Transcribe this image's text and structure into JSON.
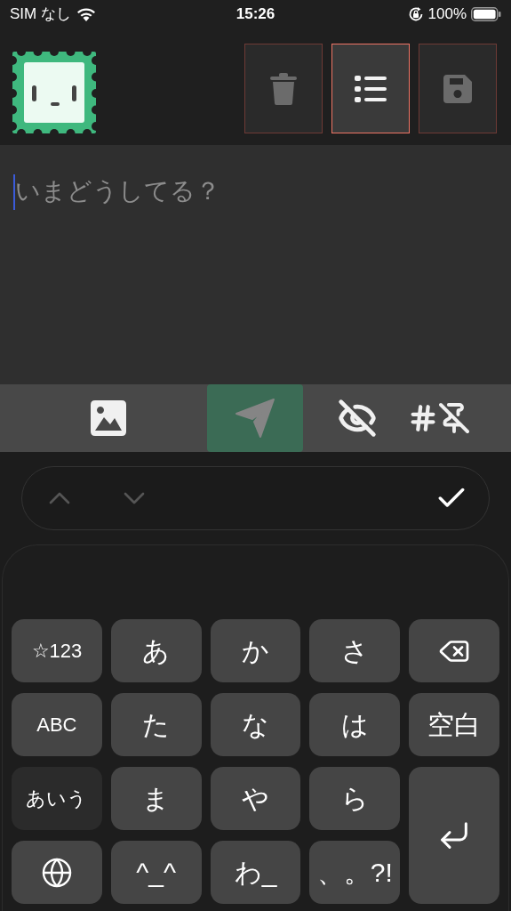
{
  "status_bar": {
    "carrier": "SIM なし",
    "time": "15:26",
    "battery": "100%"
  },
  "header": {
    "buttons": [
      {
        "kind": "trash",
        "selected": false
      },
      {
        "kind": "list",
        "selected": true
      },
      {
        "kind": "save",
        "selected": false
      }
    ]
  },
  "composer": {
    "placeholder": "いまどうしてる？"
  },
  "toolbar": [
    {
      "kind": "image",
      "selected": false
    },
    {
      "kind": "send",
      "selected": true
    },
    {
      "kind": "visibility",
      "selected": false
    },
    {
      "kind": "hashtag-pin",
      "selected": false
    }
  ],
  "accessory_bar": [
    {
      "kind": "up",
      "disabled": true
    },
    {
      "kind": "down",
      "disabled": true
    },
    {
      "kind": "done",
      "disabled": false
    }
  ],
  "keyboard": [
    {
      "kind": "mode",
      "label": "☆123",
      "selected": false
    },
    {
      "kind": "char",
      "label": "あ"
    },
    {
      "kind": "char",
      "label": "か"
    },
    {
      "kind": "char",
      "label": "さ"
    },
    {
      "kind": "delete"
    },
    {
      "kind": "mode",
      "label": "ABC",
      "selected": false
    },
    {
      "kind": "char",
      "label": "た"
    },
    {
      "kind": "char",
      "label": "な"
    },
    {
      "kind": "char",
      "label": "は"
    },
    {
      "kind": "char",
      "label": "空白"
    },
    {
      "kind": "mode",
      "label": "あいう",
      "selected": true
    },
    {
      "kind": "char",
      "label": "ま"
    },
    {
      "kind": "char",
      "label": "や"
    },
    {
      "kind": "char",
      "label": "ら"
    },
    {
      "kind": "enter"
    },
    {
      "kind": "globe"
    },
    {
      "kind": "char",
      "label": "^_^"
    },
    {
      "kind": "char",
      "label": "わ_"
    },
    {
      "kind": "char",
      "label": "、。?!"
    }
  ]
}
